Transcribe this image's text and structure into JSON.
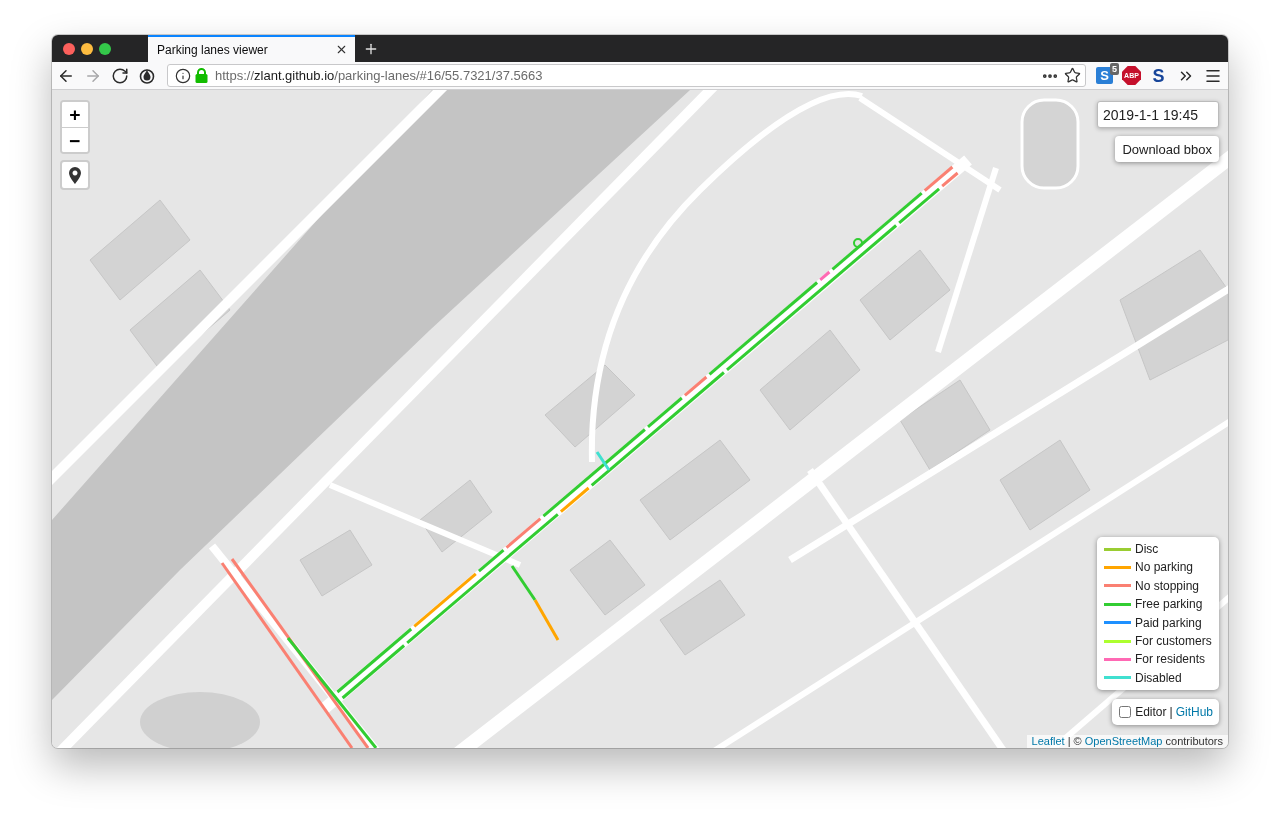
{
  "tabs": [
    {
      "title": "Parking lanes viewer",
      "selected": true
    }
  ],
  "toolbar": {
    "nav": [
      {
        "kind": "back",
        "disabled": false
      },
      {
        "kind": "forward",
        "disabled": true
      },
      {
        "kind": "reload",
        "disabled": false
      }
    ],
    "url": {
      "scheme": "https://",
      "host": "zlant.github.io",
      "path": "/parking-lanes/#16/55.7321/37.5663"
    },
    "bookmarked": false,
    "extensions": [
      {
        "kind": "tile",
        "glyph": "S",
        "badge": "5"
      },
      {
        "kind": "octagon",
        "glyph": "ABP"
      },
      {
        "kind": "letter",
        "glyph": "S"
      }
    ]
  },
  "map": {
    "zoom": [
      "+",
      "−"
    ],
    "date": "2019-1-1 19:45",
    "download_button": "Download bbox",
    "legend": [
      {
        "label": "Disc",
        "color": "#9acd32"
      },
      {
        "label": "No parking",
        "color": "#ffa500"
      },
      {
        "label": "No stopping",
        "color": "#fa8072"
      },
      {
        "label": "Free parking",
        "color": "#32cd32"
      },
      {
        "label": "Paid parking",
        "color": "#1e90ff"
      },
      {
        "label": "For customers",
        "color": "#adff2f"
      },
      {
        "label": "For residents",
        "color": "#ff69b4"
      },
      {
        "label": "Disabled",
        "color": "#40e0d0"
      }
    ],
    "editor": {
      "label": "Editor",
      "checked": false
    },
    "separator": "|",
    "github_link": "GitHub",
    "attribution": [
      {
        "kind": "link",
        "text": "Leaflet"
      },
      {
        "kind": "text",
        "text": "| ©"
      },
      {
        "kind": "link",
        "text": "OpenStreetMap"
      },
      {
        "kind": "text",
        "text": "contributors"
      }
    ]
  }
}
